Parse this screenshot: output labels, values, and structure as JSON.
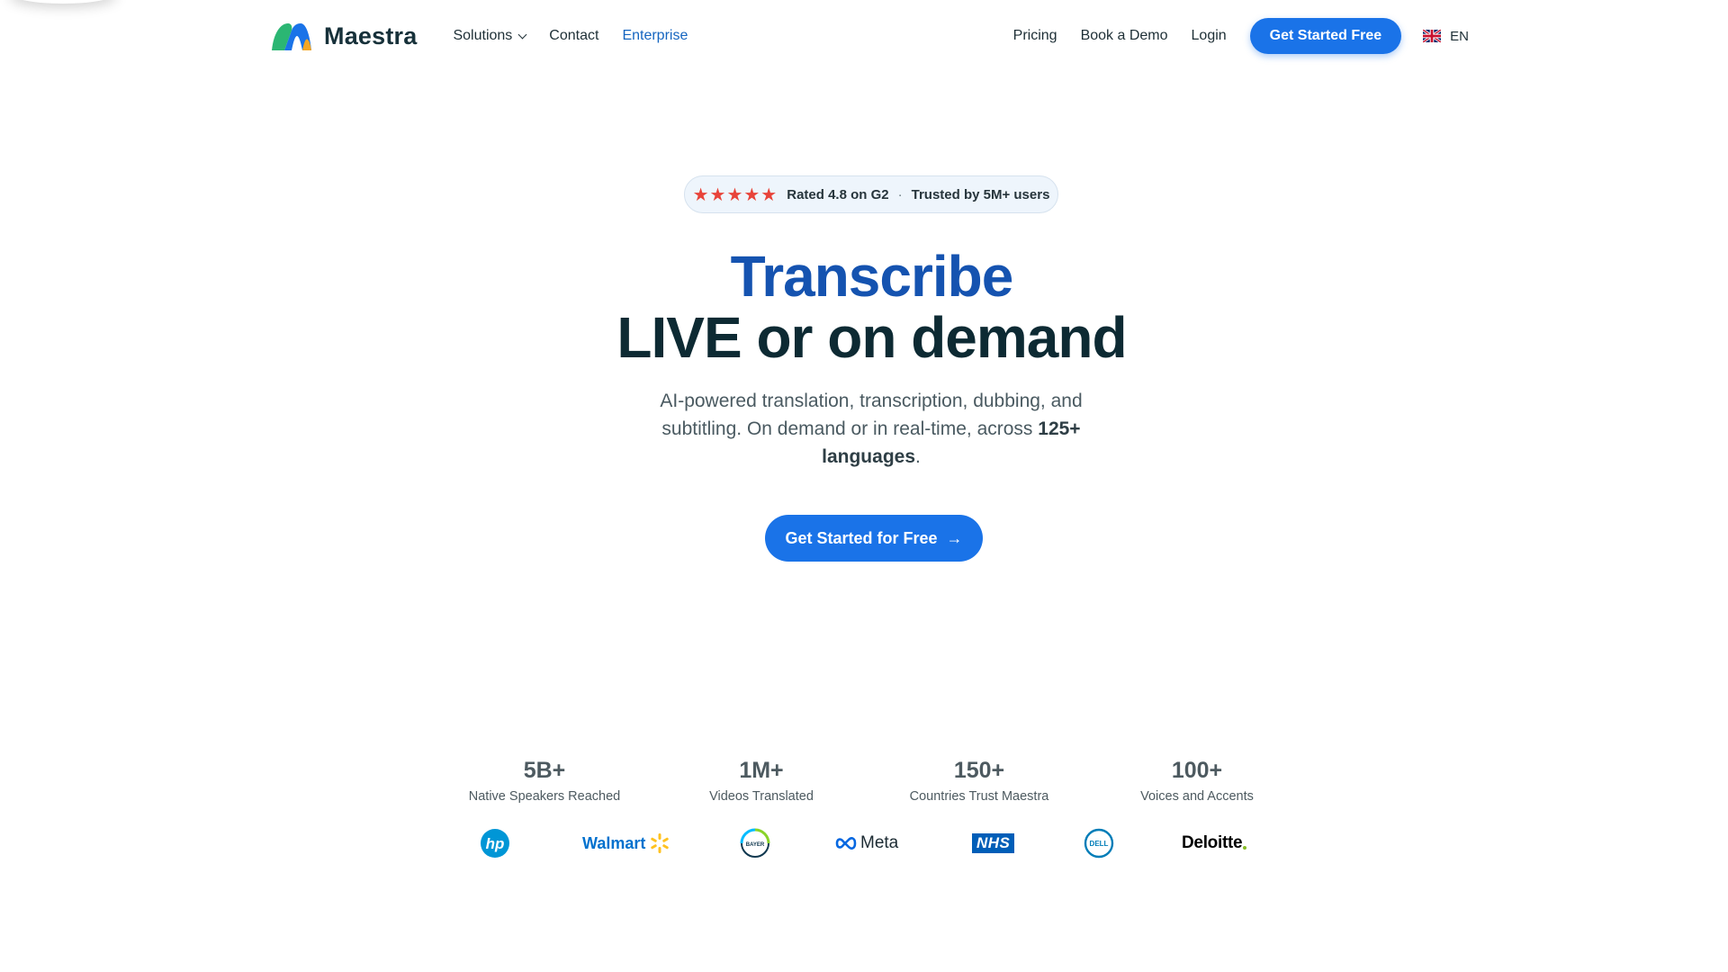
{
  "nav": {
    "brand": "Maestra",
    "links": {
      "solutions": "Solutions",
      "contact": "Contact",
      "enterprise": "Enterprise"
    },
    "right": {
      "pricing": "Pricing",
      "demo": "Book a Demo",
      "login": "Login",
      "cta": "Get Started Free",
      "lang": "EN"
    }
  },
  "hero": {
    "stars": "★★★★★",
    "rating": "Rated 4.8 on G2",
    "sep": "·",
    "trusted": "Trusted by 5M+ users",
    "title_line1": "Transcribe",
    "title_line2": "LIVE or on demand",
    "sub_a": "AI-powered translation, transcription, dubbing, and subtitling. On demand or in real-time, across ",
    "sub_b": "125+ languages",
    "sub_c": ".",
    "cta": "Get Started for Free",
    "cta_arrow": "→"
  },
  "stats": [
    {
      "value": "5B+",
      "label": "Native Speakers Reached"
    },
    {
      "value": "1M+",
      "label": "Videos Translated"
    },
    {
      "value": "150+",
      "label": "Countries Trust Maestra"
    },
    {
      "value": "100+",
      "label": "Voices and Accents"
    }
  ],
  "logos": {
    "hp": "hp",
    "walmart": "Walmart",
    "bayer": "BAYER",
    "meta": "Meta",
    "nhs": "NHS",
    "dell": "DELL",
    "deloitte": "Deloitte"
  },
  "colors": {
    "primary": "#1a73e8",
    "title_blue": "#1553b0",
    "star": "#e8443a"
  }
}
